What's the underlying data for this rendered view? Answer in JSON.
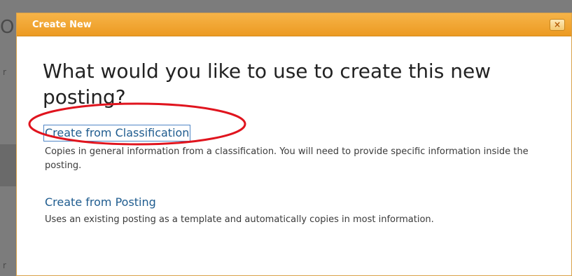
{
  "dialog": {
    "title": "Create New",
    "close_label": "×",
    "heading": "What would you like to use to create this new posting?",
    "options": [
      {
        "label": "Create from Classification",
        "description": "Copies in general information from a classification. You will need to provide specific information inside the posting."
      },
      {
        "label": "Create from Posting",
        "description": "Uses an existing posting as a template and automatically copies in most information."
      }
    ]
  },
  "annotation": {
    "shape": "ellipse",
    "color": "#e0141e",
    "target": "Create from Classification"
  },
  "colors": {
    "header_orange": "#ec9a22",
    "link_blue": "#1f5c8f",
    "backdrop_gray": "#7c7c7c"
  }
}
